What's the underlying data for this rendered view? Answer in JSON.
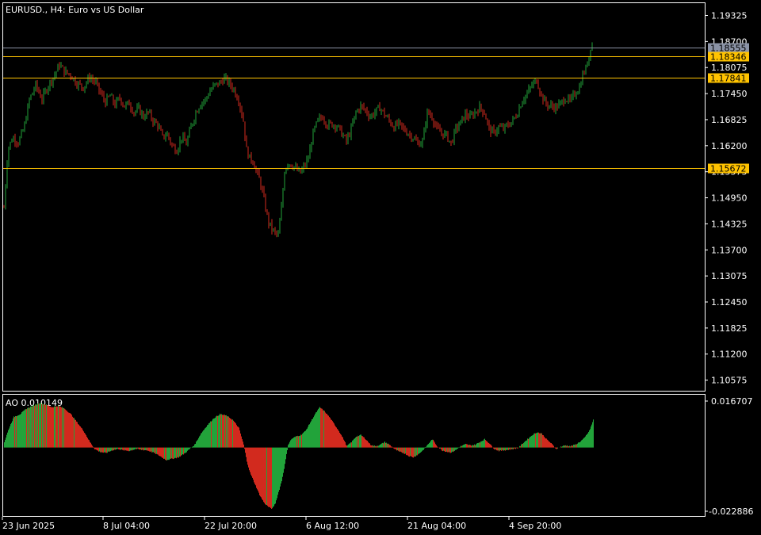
{
  "main_chart": {
    "symbol": "EURUSD.",
    "timeframe": "H4",
    "description": "Euro vs US Dollar",
    "title_text": "EURUSD., H4:  Euro vs US Dollar",
    "y_ticks": [
      "1.19325",
      "1.18700",
      "1.18075",
      "1.17450",
      "1.16825",
      "1.16200",
      "1.15575",
      "1.14950",
      "1.14325",
      "1.13700",
      "1.13075",
      "1.12450",
      "1.11825",
      "1.11200",
      "1.10575"
    ],
    "price_levels": [
      {
        "label": "1.18555",
        "kind": "bid",
        "color": "#8b93a6"
      },
      {
        "label": "1.18346",
        "kind": "hline",
        "color": "#ffc300"
      },
      {
        "label": "1.17841",
        "kind": "hline",
        "color": "#ffc300"
      },
      {
        "label": "1.15672",
        "kind": "hline",
        "color": "#ffc300"
      }
    ],
    "bull_color": "#22a33a",
    "bear_color": "#d22a1e"
  },
  "indicator": {
    "name": "AO",
    "value": "0.010149",
    "label_text": "AO 0.010149",
    "y_max_label": "0.016707",
    "y_min_label": "-0.022886",
    "up_color": "#22a33a",
    "down_color": "#d22a1e"
  },
  "x_axis": {
    "ticks": [
      "23 Jun 2025",
      "8 Jul 04:00",
      "22 Jul 20:00",
      "6 Aug 12:00",
      "21 Aug 04:00",
      "4 Sep 20:00"
    ]
  },
  "chart_data": {
    "type": "candlestick",
    "price_range": [
      1.1032,
      1.1962
    ],
    "ao_range": [
      -0.022886,
      0.016707
    ],
    "close_path": [
      [
        0,
        1.1472
      ],
      [
        5,
        1.1612
      ],
      [
        11,
        1.164
      ],
      [
        18,
        1.1628
      ],
      [
        25,
        1.166
      ],
      [
        32,
        1.173
      ],
      [
        40,
        1.1765
      ],
      [
        48,
        1.1732
      ],
      [
        56,
        1.1765
      ],
      [
        64,
        1.179
      ],
      [
        70,
        1.1815
      ],
      [
        76,
        1.1798
      ],
      [
        84,
        1.179
      ],
      [
        92,
        1.177
      ],
      [
        100,
        1.176
      ],
      [
        108,
        1.1785
      ],
      [
        116,
        1.177
      ],
      [
        122,
        1.1745
      ],
      [
        128,
        1.1725
      ],
      [
        134,
        1.174
      ],
      [
        140,
        1.1718
      ],
      [
        146,
        1.1735
      ],
      [
        152,
        1.1715
      ],
      [
        158,
        1.1722
      ],
      [
        164,
        1.17
      ],
      [
        170,
        1.1708
      ],
      [
        176,
        1.169
      ],
      [
        182,
        1.17
      ],
      [
        188,
        1.168
      ],
      [
        194,
        1.167
      ],
      [
        200,
        1.164
      ],
      [
        206,
        1.1648
      ],
      [
        212,
        1.162
      ],
      [
        218,
        1.161
      ],
      [
        224,
        1.164
      ],
      [
        230,
        1.1625
      ],
      [
        236,
        1.1665
      ],
      [
        242,
        1.17
      ],
      [
        248,
        1.1722
      ],
      [
        254,
        1.173
      ],
      [
        260,
        1.1752
      ],
      [
        266,
        1.1765
      ],
      [
        272,
        1.177
      ],
      [
        278,
        1.1782
      ],
      [
        284,
        1.177
      ],
      [
        290,
        1.1755
      ],
      [
        296,
        1.173
      ],
      [
        302,
        1.168
      ],
      [
        306,
        1.161
      ],
      [
        310,
        1.159
      ],
      [
        314,
        1.1585
      ],
      [
        318,
        1.156
      ],
      [
        322,
        1.154
      ],
      [
        326,
        1.151
      ],
      [
        330,
        1.147
      ],
      [
        334,
        1.1435
      ],
      [
        338,
        1.142
      ],
      [
        342,
        1.141
      ],
      [
        346,
        1.1405
      ],
      [
        350,
        1.147
      ],
      [
        354,
        1.156
      ],
      [
        358,
        1.158
      ],
      [
        362,
        1.1575
      ],
      [
        366,
        1.157
      ],
      [
        370,
        1.156
      ],
      [
        374,
        1.1555
      ],
      [
        378,
        1.1568
      ],
      [
        384,
        1.159
      ],
      [
        390,
        1.165
      ],
      [
        396,
        1.168
      ],
      [
        402,
        1.169
      ],
      [
        408,
        1.167
      ],
      [
        414,
        1.1672
      ],
      [
        420,
        1.1668
      ],
      [
        426,
        1.165
      ],
      [
        432,
        1.163
      ],
      [
        438,
        1.166
      ],
      [
        444,
        1.17
      ],
      [
        450,
        1.1715
      ],
      [
        456,
        1.1705
      ],
      [
        462,
        1.169
      ],
      [
        468,
        1.17
      ],
      [
        474,
        1.1712
      ],
      [
        480,
        1.1695
      ],
      [
        486,
        1.168
      ],
      [
        492,
        1.1665
      ],
      [
        498,
        1.1672
      ],
      [
        504,
        1.166
      ],
      [
        510,
        1.165
      ],
      [
        516,
        1.164
      ],
      [
        522,
        1.1625
      ],
      [
        528,
        1.163
      ],
      [
        534,
        1.17
      ],
      [
        540,
        1.169
      ],
      [
        546,
        1.166
      ],
      [
        552,
        1.165
      ],
      [
        558,
        1.1645
      ],
      [
        564,
        1.1625
      ],
      [
        570,
        1.166
      ],
      [
        576,
        1.1675
      ],
      [
        582,
        1.1695
      ],
      [
        588,
        1.1688
      ],
      [
        594,
        1.17
      ],
      [
        600,
        1.1712
      ],
      [
        606,
        1.17
      ],
      [
        612,
        1.166
      ],
      [
        618,
        1.165
      ],
      [
        624,
        1.1665
      ],
      [
        630,
        1.166
      ],
      [
        636,
        1.167
      ],
      [
        642,
        1.168
      ],
      [
        648,
        1.17
      ],
      [
        654,
        1.173
      ],
      [
        660,
        1.1745
      ],
      [
        666,
        1.1765
      ],
      [
        672,
        1.1778
      ],
      [
        678,
        1.174
      ],
      [
        684,
        1.172
      ],
      [
        690,
        1.1715
      ],
      [
        696,
        1.1712
      ],
      [
        702,
        1.172
      ],
      [
        708,
        1.1735
      ],
      [
        714,
        1.1725
      ],
      [
        720,
        1.1745
      ],
      [
        726,
        1.176
      ],
      [
        730,
        1.179
      ],
      [
        734,
        1.1805
      ],
      [
        738,
        1.1835
      ],
      [
        741,
        1.187
      ],
      [
        743,
        1.1858
      ]
    ],
    "ao_path": [
      [
        0,
        0.002
      ],
      [
        6,
        0.007
      ],
      [
        12,
        0.011
      ],
      [
        20,
        0.012
      ],
      [
        28,
        0.014
      ],
      [
        36,
        0.015
      ],
      [
        44,
        0.016
      ],
      [
        52,
        0.0155
      ],
      [
        60,
        0.0145
      ],
      [
        68,
        0.015
      ],
      [
        76,
        0.014
      ],
      [
        84,
        0.012
      ],
      [
        92,
        0.009
      ],
      [
        100,
        0.006
      ],
      [
        108,
        0.002
      ],
      [
        114,
        -0.0005
      ],
      [
        120,
        -0.0015
      ],
      [
        128,
        -0.002
      ],
      [
        136,
        -0.001
      ],
      [
        144,
        -0.0005
      ],
      [
        150,
        -0.001
      ],
      [
        158,
        -0.0012
      ],
      [
        166,
        -0.0005
      ],
      [
        172,
        -0.0008
      ],
      [
        180,
        -0.001
      ],
      [
        188,
        -0.0018
      ],
      [
        196,
        -0.003
      ],
      [
        204,
        -0.0045
      ],
      [
        212,
        -0.004
      ],
      [
        220,
        -0.0035
      ],
      [
        228,
        -0.002
      ],
      [
        234,
        -0.0005
      ],
      [
        240,
        0.001
      ],
      [
        248,
        0.005
      ],
      [
        256,
        0.008
      ],
      [
        264,
        0.0105
      ],
      [
        272,
        0.012
      ],
      [
        280,
        0.0115
      ],
      [
        288,
        0.01
      ],
      [
        296,
        0.007
      ],
      [
        302,
        0.001
      ],
      [
        306,
        -0.005
      ],
      [
        310,
        -0.009
      ],
      [
        316,
        -0.013
      ],
      [
        322,
        -0.017
      ],
      [
        328,
        -0.02
      ],
      [
        334,
        -0.0215
      ],
      [
        338,
        -0.022
      ],
      [
        342,
        -0.02
      ],
      [
        346,
        -0.016
      ],
      [
        350,
        -0.012
      ],
      [
        354,
        -0.006
      ],
      [
        358,
        0.001
      ],
      [
        362,
        0.003
      ],
      [
        368,
        0.004
      ],
      [
        374,
        0.0045
      ],
      [
        380,
        0.006
      ],
      [
        386,
        0.009
      ],
      [
        392,
        0.012
      ],
      [
        398,
        0.0145
      ],
      [
        404,
        0.013
      ],
      [
        410,
        0.011
      ],
      [
        416,
        0.0085
      ],
      [
        422,
        0.006
      ],
      [
        428,
        0.003
      ],
      [
        432,
        0.0005
      ],
      [
        438,
        0.002
      ],
      [
        444,
        0.004
      ],
      [
        450,
        0.0045
      ],
      [
        456,
        0.003
      ],
      [
        462,
        0.001
      ],
      [
        468,
        0.0005
      ],
      [
        474,
        0.001
      ],
      [
        480,
        0.002
      ],
      [
        486,
        0.001
      ],
      [
        492,
        -0.0005
      ],
      [
        498,
        -0.0015
      ],
      [
        504,
        -0.002
      ],
      [
        510,
        -0.003
      ],
      [
        516,
        -0.0035
      ],
      [
        522,
        -0.0025
      ],
      [
        528,
        -0.001
      ],
      [
        534,
        0.001
      ],
      [
        540,
        0.003
      ],
      [
        546,
        0.0005
      ],
      [
        552,
        -0.001
      ],
      [
        558,
        -0.0015
      ],
      [
        564,
        -0.0018
      ],
      [
        570,
        -0.0008
      ],
      [
        576,
        0.0005
      ],
      [
        582,
        0.0012
      ],
      [
        588,
        0.0008
      ],
      [
        594,
        0.001
      ],
      [
        600,
        0.002
      ],
      [
        606,
        0.003
      ],
      [
        612,
        0.0015
      ],
      [
        618,
        -0.0005
      ],
      [
        624,
        -0.0012
      ],
      [
        630,
        -0.001
      ],
      [
        636,
        -0.0008
      ],
      [
        642,
        -0.0005
      ],
      [
        648,
        -0.0002
      ],
      [
        654,
        0.0015
      ],
      [
        660,
        0.003
      ],
      [
        666,
        0.0045
      ],
      [
        672,
        0.0055
      ],
      [
        678,
        0.005
      ],
      [
        684,
        0.003
      ],
      [
        690,
        0.0015
      ],
      [
        696,
        -0.0005
      ],
      [
        702,
        0.0003
      ],
      [
        708,
        0.0008
      ],
      [
        714,
        0.0005
      ],
      [
        720,
        0.001
      ],
      [
        726,
        0.002
      ],
      [
        732,
        0.0035
      ],
      [
        738,
        0.006
      ],
      [
        742,
        0.009
      ],
      [
        743,
        0.0101
      ]
    ]
  }
}
